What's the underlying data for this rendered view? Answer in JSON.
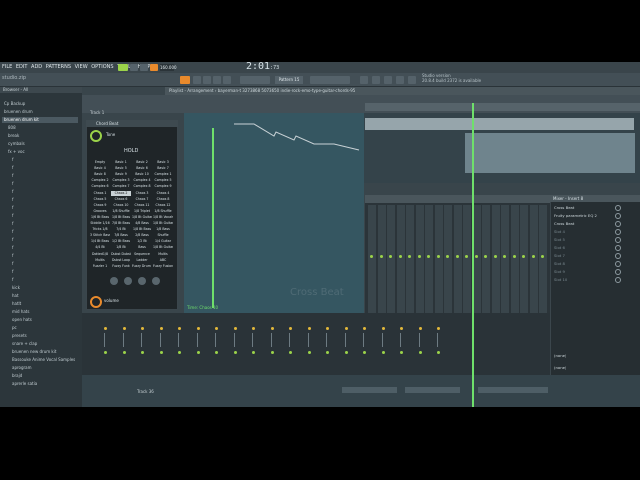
{
  "menu": [
    "FILE",
    "EDIT",
    "ADD",
    "PATTERNS",
    "VIEW",
    "OPTIONS",
    "TOOLS",
    "HELP"
  ],
  "toolbar": {
    "hint": "studio.zip",
    "bpm": "160.000",
    "time": "2:01",
    "time_sub": ":73",
    "pattern": "Pattern 15",
    "news": "Studio version\n20.8.4 build 2372 is available"
  },
  "browser": {
    "header": "Browser - All",
    "items": [
      "Cp Backup",
      "bruenen drum",
      "bruenen drum kit",
      "808",
      "break",
      "cymbals",
      "fx + voc",
      "f",
      "f",
      "f",
      "f",
      "f",
      "f",
      "f",
      "f",
      "f",
      "f",
      "f",
      "f",
      "f",
      "f",
      "f",
      "f",
      "kick",
      "hat",
      "hatlt",
      "mid hats",
      "open hats",
      "pc",
      "presets",
      "snare + clap",
      "bruenen new drum kit",
      "Bassouke Anime Vocal Samples",
      "aprogram",
      "brajd",
      "aprerle satia"
    ],
    "selected_index": 2
  },
  "playlist": {
    "title": "Playlist - Arrangement › bayerman-t 3273868 5073650 indie-rock-emo-type-guitar-chords-95",
    "track_labels": [
      "Track 1",
      "Track 36"
    ]
  },
  "plugin": {
    "title": "Chord Beat",
    "tone": "Tone",
    "hold": "HOLD",
    "volume": "volume",
    "chords": [
      [
        "Empty",
        "Basic 1",
        "Basic 2",
        "Basic 3"
      ],
      [
        "Basic 4",
        "Basic 5",
        "Basic 6",
        "Basic 7"
      ],
      [
        "Basic 8",
        "Basic 9",
        "Basic 10",
        "Complex 1"
      ],
      [
        "Complex 2",
        "Complex 3",
        "Complex 4",
        "Complex 5"
      ],
      [
        "Complex 6",
        "Complex 7",
        "Complex 8",
        "Complex 9"
      ],
      [
        "Chaos 1",
        "Chaos 2",
        "Chaos 3",
        "Chaos 4"
      ],
      [
        "Chaos 5",
        "Chaos 6",
        "Chaos 7",
        "Chaos 8"
      ],
      [
        "Chaos 9",
        "Chaos 10",
        "Chaos 11",
        "Chaos 12"
      ],
      [
        "Grooves",
        "1/8 Shuffle",
        "1/8 Triplet",
        "1/8 Shuffle"
      ],
      [
        "1/6 Bt Bass",
        "1/8 Bt Bass",
        "1/8 Bt Guitar",
        "1/8 Bt Vocals"
      ],
      [
        "Stiddle 1/16",
        "7/8 Bt Bass",
        "4/8 Bass",
        "1/8 Bt Guitar"
      ],
      [
        "Tricks 1/8",
        "7/4 Bt",
        "1/8 Bt Bass",
        "1/8 Bass"
      ],
      [
        "3 Stitch Bass",
        "7/8 Bass",
        "2/8 Bass",
        "Shuffle"
      ],
      [
        "1/4 Bt Bass",
        "1/2 Bt Bass",
        "1/2 Bt",
        "1/4 Guitar"
      ],
      [
        "4/4 Bt",
        "1/8 Bt",
        "Bass",
        "1/8 Bt Guitar"
      ],
      [
        "Dotted1/8",
        "Dubst Dubst",
        "Sequence",
        "Multis"
      ],
      [
        "Multis",
        "Dubst Loop",
        "Ladder",
        "ABC"
      ],
      [
        "Fuzzler 1",
        "Fuzzy Funk",
        "Fuzzy Drum 4",
        "Fuzzy Fusion"
      ]
    ],
    "lit_cell": [
      5,
      1
    ]
  },
  "graph": {
    "time_label": "Time: Chaos 10",
    "watermark": "Cross Beat"
  },
  "mixer_panel": {
    "header": "Mixer - Insert 8",
    "slots": [
      "Cross Beat",
      "Fruity parametric EQ 2",
      "Cross Beat",
      "Slot 4",
      "Slot 5",
      "Slot 6",
      "Slot 7",
      "Slot 8",
      "Slot 9",
      "Slot 10"
    ],
    "active_slots": 3,
    "footer": [
      "(none)",
      "(none)"
    ]
  },
  "colors": {
    "accent_green": "#9bd34a",
    "accent_orange": "#e98a2c",
    "playhead": "#6fe06b"
  }
}
